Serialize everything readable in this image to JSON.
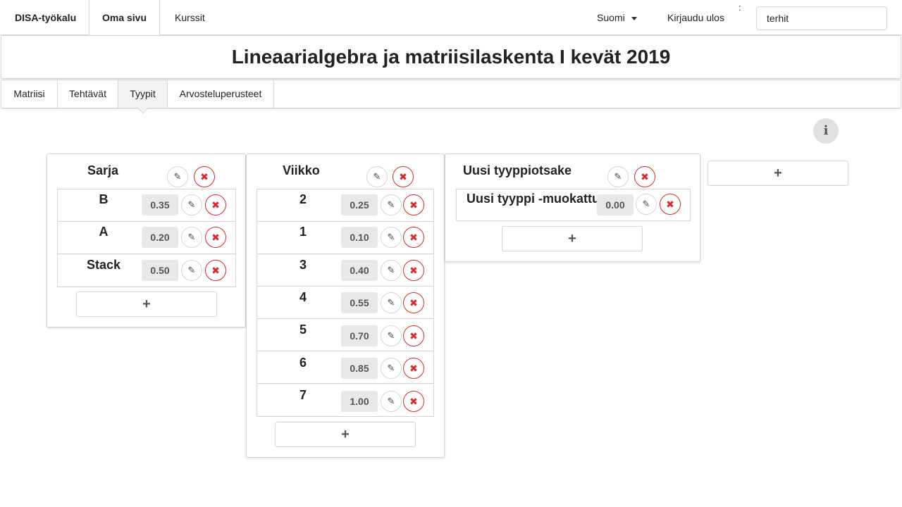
{
  "nav": {
    "brand": "DISA-työkalu",
    "my_page": "Oma sivu",
    "courses": "Kurssit",
    "language": "Suomi",
    "logout": "Kirjaudu ulos",
    "colon": ":",
    "username": "terhit"
  },
  "course_title": "Lineaarialgebra ja matriisilaskenta I kevät 2019",
  "subtabs": [
    "Matriisi",
    "Tehtävät",
    "Tyypit",
    "Arvosteluperusteet"
  ],
  "selected_subtab": "Tyypit",
  "info_label": "i",
  "add_label": "+",
  "edit_icon": "✎",
  "delete_icon": "✖",
  "categories": [
    {
      "title": "Sarja",
      "types": [
        {
          "name": "B",
          "weight": "0.35"
        },
        {
          "name": "A",
          "weight": "0.20"
        },
        {
          "name": "Stack",
          "weight": "0.50"
        }
      ]
    },
    {
      "title": "Viikko",
      "types": [
        {
          "name": "2",
          "weight": "0.25"
        },
        {
          "name": "1",
          "weight": "0.10"
        },
        {
          "name": "3",
          "weight": "0.40"
        },
        {
          "name": "4",
          "weight": "0.55"
        },
        {
          "name": "5",
          "weight": "0.70"
        },
        {
          "name": "6",
          "weight": "0.85"
        },
        {
          "name": "7",
          "weight": "1.00"
        }
      ]
    },
    {
      "title": "Uusi tyyppiotsake",
      "types": [
        {
          "name": "Uusi tyyppi -muokattu",
          "weight": "0.00"
        }
      ]
    }
  ],
  "colors": {
    "delete": "#db2828",
    "border": "#d4d4d5",
    "weight_bg": "#e8e8e8"
  }
}
